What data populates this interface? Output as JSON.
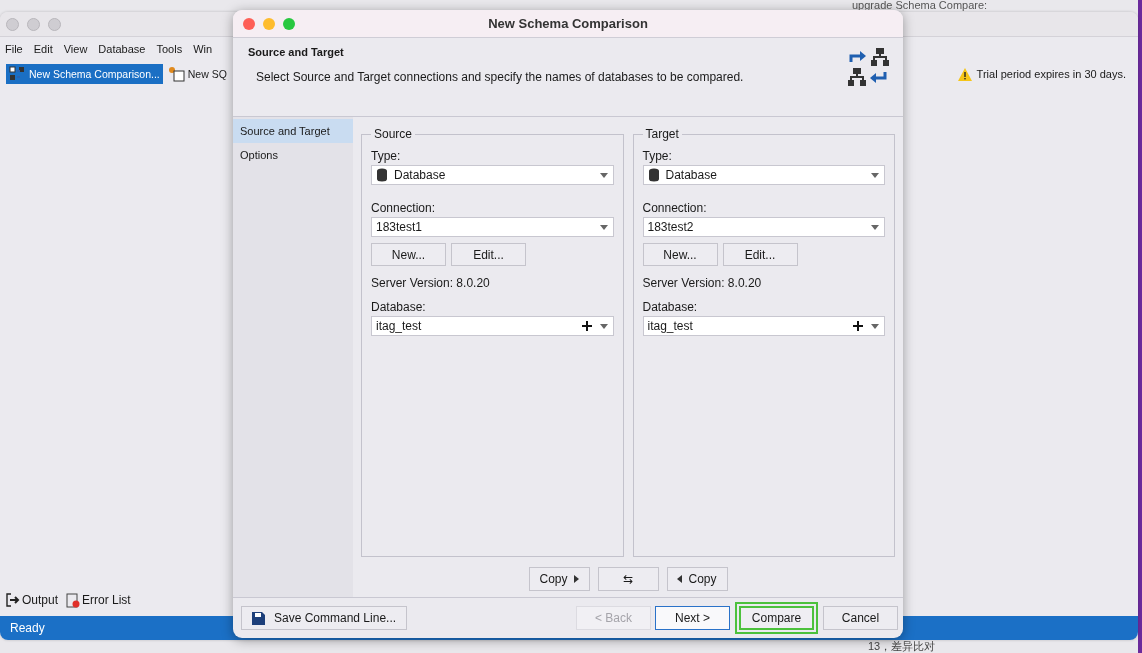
{
  "background_doc": {
    "top_text": "upgrade Schema Compare:",
    "bottom_text": "13，差异比对"
  },
  "app": {
    "menu": [
      "File",
      "Edit",
      "View",
      "Database",
      "Tools",
      "Win"
    ],
    "doc_tabs": [
      {
        "label": "New Schema Comparison...",
        "selected": true,
        "kind": "schema"
      },
      {
        "label": "New SQ",
        "selected": false,
        "kind": "sql"
      }
    ],
    "notice": "Trial period expires in 30 days.",
    "bottom_tabs": [
      {
        "label": "Output",
        "kind": "output"
      },
      {
        "label": "Error List",
        "kind": "errors"
      }
    ],
    "status_bar": "Ready"
  },
  "dialog": {
    "title": "New Schema Comparison",
    "header": {
      "title": "Source and Target",
      "description": "Select Source and Target connections and specify the names of databases to be compared."
    },
    "sidebar": [
      {
        "label": "Source and Target",
        "selected": true
      },
      {
        "label": "Options",
        "selected": false
      }
    ],
    "panels": [
      {
        "title": "Source",
        "type_label": "Type:",
        "type_value": "Database",
        "connection_label": "Connection:",
        "connection_value": "183test1",
        "new_button": "New...",
        "edit_button": "Edit...",
        "server_version": "Server Version: 8.0.20",
        "database_label": "Database:",
        "database_value": "itag_test"
      },
      {
        "title": "Target",
        "type_label": "Type:",
        "type_value": "Database",
        "connection_label": "Connection:",
        "connection_value": "183test2",
        "new_button": "New...",
        "edit_button": "Edit...",
        "server_version": "Server Version: 8.0.20",
        "database_label": "Database:",
        "database_value": "itag_test"
      }
    ],
    "copy_buttons": [
      {
        "label": "Copy",
        "kind": "copy-right"
      },
      {
        "label": "⇆",
        "kind": "swap"
      },
      {
        "label": "Copy",
        "kind": "copy-left"
      }
    ],
    "footer_buttons": [
      {
        "label": "Save Command Line...",
        "kind": "save"
      },
      {
        "label": "< Back",
        "kind": "nav",
        "disabled": true,
        "default": false,
        "highlighted": false
      },
      {
        "label": "Next >",
        "kind": "nav",
        "disabled": false,
        "default": true,
        "highlighted": false
      },
      {
        "label": "Compare",
        "kind": "nav",
        "disabled": false,
        "default": false,
        "highlighted": true
      },
      {
        "label": "Cancel",
        "kind": "nav",
        "disabled": false,
        "default": false,
        "highlighted": false
      }
    ]
  }
}
